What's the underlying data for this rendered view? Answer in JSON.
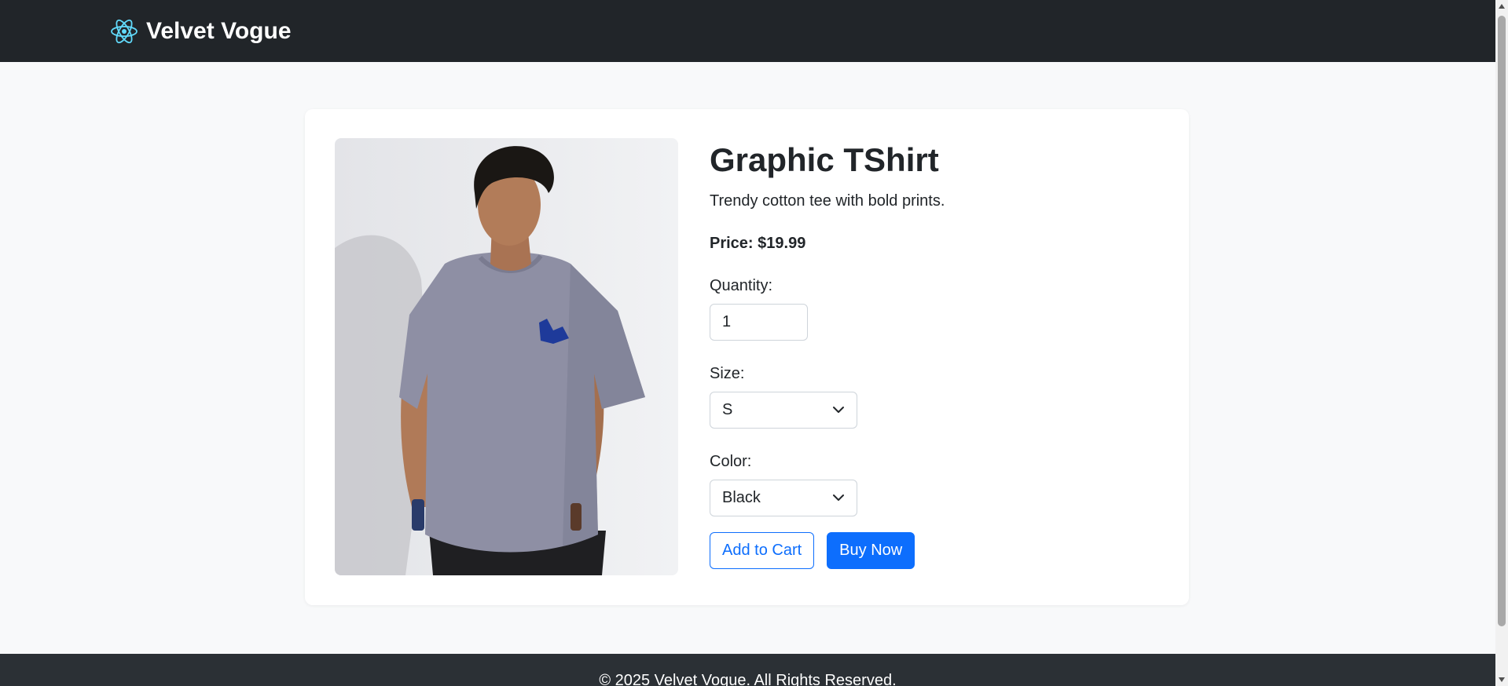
{
  "navbar": {
    "brand_text": "Velvet Vogue",
    "brand_icon": "react-atom-icon",
    "brand_icon_color": "#61dafb",
    "background": "#212529"
  },
  "product": {
    "title": "Graphic TShirt",
    "description": "Trendy cotton tee with bold prints.",
    "price_label": "Price:",
    "price_value": "$19.99",
    "image": "model-in-grey-tshirt",
    "quantity_label": "Quantity:",
    "quantity_value": "1",
    "size_label": "Size:",
    "size_value": "S",
    "color_label": "Color:",
    "color_value": "Black",
    "add_to_cart_label": "Add to Cart",
    "buy_now_label": "Buy Now"
  },
  "footer": {
    "text": "© 2025 Velvet Vogue. All Rights Reserved."
  },
  "colors": {
    "primary": "#0d6efd",
    "page_bg": "#f8f9fa",
    "footer_bg": "#2b3035"
  }
}
